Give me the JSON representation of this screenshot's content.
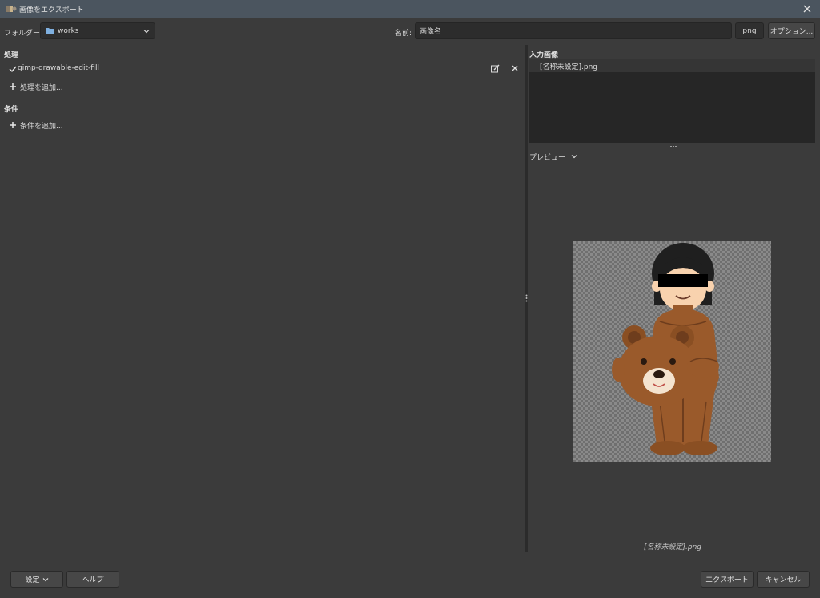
{
  "window": {
    "title": "画像をエクスポート"
  },
  "folder": {
    "label": "フォルダー:",
    "value": "works"
  },
  "name": {
    "label": "名前:",
    "value": "画像名"
  },
  "extension": {
    "value": "png"
  },
  "options_button": "オプション...",
  "processing": {
    "title": "処理",
    "items": [
      {
        "label": "gimp-drawable-edit-fill",
        "checked": true
      }
    ],
    "add_label": "処理を追加..."
  },
  "conditions": {
    "title": "条件",
    "add_label": "条件を追加..."
  },
  "input_images": {
    "title": "入力画像",
    "items": [
      "[名称未設定].png"
    ]
  },
  "preview": {
    "label": "プレビュー",
    "caption": "[名称未設定].png"
  },
  "buttons": {
    "settings": "設定",
    "help": "ヘルプ",
    "export": "エクスポート",
    "cancel": "キャンセル"
  },
  "colors": {
    "title_bar": "#4b555f",
    "background": "#3b3b3b",
    "folder_icon": "#7fb0e0"
  },
  "icons": {
    "app": "gimp-icon",
    "close": "close-icon",
    "folder": "folder-icon",
    "dropdown": "chevron-down-icon",
    "check": "check-icon",
    "edit": "edit-icon",
    "remove": "remove-icon",
    "add": "plus-icon"
  }
}
